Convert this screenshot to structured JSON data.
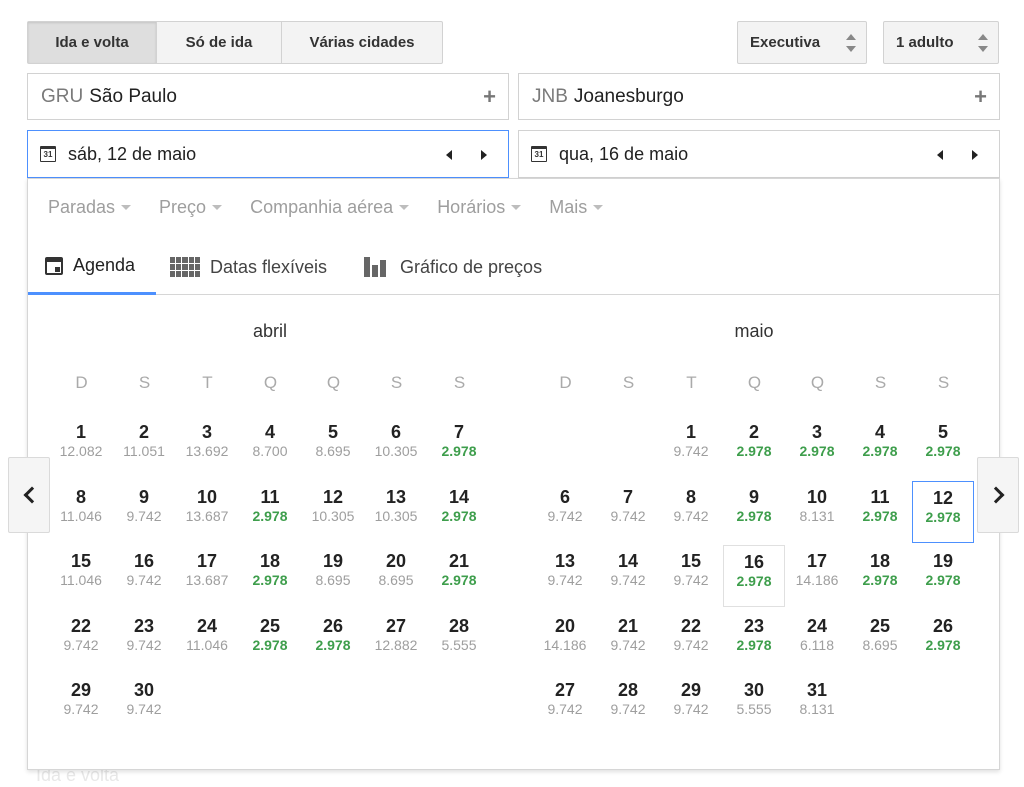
{
  "trip_type": {
    "options": [
      "Ida e volta",
      "Só de ida",
      "Várias cidades"
    ],
    "selected": "Ida e volta"
  },
  "cabin": {
    "value": "Executiva"
  },
  "passengers": {
    "value": "1 adulto"
  },
  "origin": {
    "code": "GRU",
    "city": "São Paulo",
    "add_icon": "plus-icon"
  },
  "destination": {
    "code": "JNB",
    "city": "Joanesburgo",
    "add_icon": "plus-icon"
  },
  "departure": {
    "label": "sáb, 12 de maio",
    "icon_text": "31"
  },
  "return": {
    "label": "qua, 16 de maio",
    "icon_text": "31"
  },
  "filters": [
    "Paradas",
    "Preço",
    "Companhia aérea",
    "Horários",
    "Mais"
  ],
  "view_tabs": {
    "agenda": "Agenda",
    "flex": "Datas flexíveis",
    "graph": "Gráfico de preços",
    "active": "agenda"
  },
  "weekday_labels": [
    "D",
    "S",
    "T",
    "Q",
    "Q",
    "S",
    "S"
  ],
  "colors": {
    "accent": "#4d90fe",
    "low_price": "#3e9e4c",
    "normal_price": "#9e9e9e"
  },
  "months": [
    {
      "name": "abril",
      "first_weekday": 0,
      "days": [
        {
          "d": "1",
          "p": "12.082"
        },
        {
          "d": "2",
          "p": "11.051"
        },
        {
          "d": "3",
          "p": "13.692"
        },
        {
          "d": "4",
          "p": "8.700"
        },
        {
          "d": "5",
          "p": "8.695"
        },
        {
          "d": "6",
          "p": "10.305"
        },
        {
          "d": "7",
          "p": "2.978",
          "low": true
        },
        {
          "d": "8",
          "p": "11.046"
        },
        {
          "d": "9",
          "p": "9.742"
        },
        {
          "d": "10",
          "p": "13.687"
        },
        {
          "d": "11",
          "p": "2.978",
          "low": true
        },
        {
          "d": "12",
          "p": "10.305"
        },
        {
          "d": "13",
          "p": "10.305"
        },
        {
          "d": "14",
          "p": "2.978",
          "low": true
        },
        {
          "d": "15",
          "p": "11.046"
        },
        {
          "d": "16",
          "p": "9.742"
        },
        {
          "d": "17",
          "p": "13.687"
        },
        {
          "d": "18",
          "p": "2.978",
          "low": true
        },
        {
          "d": "19",
          "p": "8.695"
        },
        {
          "d": "20",
          "p": "8.695"
        },
        {
          "d": "21",
          "p": "2.978",
          "low": true
        },
        {
          "d": "22",
          "p": "9.742"
        },
        {
          "d": "23",
          "p": "9.742"
        },
        {
          "d": "24",
          "p": "11.046"
        },
        {
          "d": "25",
          "p": "2.978",
          "low": true
        },
        {
          "d": "26",
          "p": "2.978",
          "low": true
        },
        {
          "d": "27",
          "p": "12.882"
        },
        {
          "d": "28",
          "p": "5.555"
        },
        {
          "d": "29",
          "p": "9.742"
        },
        {
          "d": "30",
          "p": "9.742"
        }
      ]
    },
    {
      "name": "maio",
      "first_weekday": 2,
      "days": [
        {
          "d": "1",
          "p": "9.742"
        },
        {
          "d": "2",
          "p": "2.978",
          "low": true
        },
        {
          "d": "3",
          "p": "2.978",
          "low": true
        },
        {
          "d": "4",
          "p": "2.978",
          "low": true
        },
        {
          "d": "5",
          "p": "2.978",
          "low": true
        },
        {
          "d": "6",
          "p": "9.742"
        },
        {
          "d": "7",
          "p": "9.742"
        },
        {
          "d": "8",
          "p": "9.742"
        },
        {
          "d": "9",
          "p": "2.978",
          "low": true
        },
        {
          "d": "10",
          "p": "8.131"
        },
        {
          "d": "11",
          "p": "2.978",
          "low": true
        },
        {
          "d": "12",
          "p": "2.978",
          "low": true,
          "state": "departure"
        },
        {
          "d": "13",
          "p": "9.742"
        },
        {
          "d": "14",
          "p": "9.742"
        },
        {
          "d": "15",
          "p": "9.742"
        },
        {
          "d": "16",
          "p": "2.978",
          "low": true,
          "state": "return"
        },
        {
          "d": "17",
          "p": "14.186"
        },
        {
          "d": "18",
          "p": "2.978",
          "low": true
        },
        {
          "d": "19",
          "p": "2.978",
          "low": true
        },
        {
          "d": "20",
          "p": "14.186"
        },
        {
          "d": "21",
          "p": "9.742"
        },
        {
          "d": "22",
          "p": "9.742"
        },
        {
          "d": "23",
          "p": "2.978",
          "low": true
        },
        {
          "d": "24",
          "p": "6.118"
        },
        {
          "d": "25",
          "p": "8.695"
        },
        {
          "d": "26",
          "p": "2.978",
          "low": true
        },
        {
          "d": "27",
          "p": "9.742"
        },
        {
          "d": "28",
          "p": "9.742"
        },
        {
          "d": "29",
          "p": "9.742"
        },
        {
          "d": "30",
          "p": "5.555"
        },
        {
          "d": "31",
          "p": "8.131"
        }
      ]
    }
  ],
  "nav": {
    "prev_icon": "chevron-left-icon",
    "next_icon": "chevron-right-icon"
  }
}
